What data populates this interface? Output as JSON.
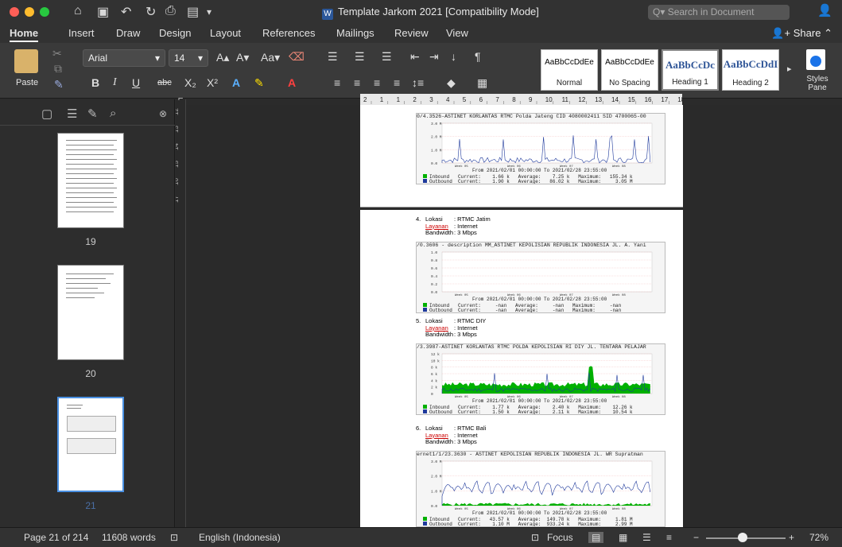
{
  "title_bar": {
    "doc_title": "Template Jarkom 2021 [Compatibility Mode]",
    "search_placeholder": "Search in Document"
  },
  "tabs": [
    "Home",
    "Insert",
    "Draw",
    "Design",
    "Layout",
    "References",
    "Mailings",
    "Review",
    "View"
  ],
  "share_label": "Share",
  "ribbon": {
    "paste_label": "Paste",
    "font_name": "Arial",
    "font_size": "14",
    "styles": [
      {
        "preview": "AaBbCcDdEe",
        "name": "Normal"
      },
      {
        "preview": "AaBbCcDdEe",
        "name": "No Spacing"
      },
      {
        "preview": "AaBbCcDc",
        "name": "Heading 1"
      },
      {
        "preview": "AaBbCcDdI",
        "name": "Heading 2"
      }
    ],
    "styles_pane_label": "Styles Pane"
  },
  "sidebar": {
    "pages": [
      "19",
      "20",
      "21"
    ]
  },
  "vruler_labels": [
    "12",
    "13",
    "14",
    "15",
    "16",
    "17"
  ],
  "hruler_labels": [
    "2",
    "1",
    "1",
    "2",
    "3",
    "4",
    "5",
    "6",
    "7",
    "8",
    "9",
    "10",
    "11",
    "12",
    "13",
    "14",
    "15",
    "16",
    "17",
    "18"
  ],
  "document": {
    "graph0": {
      "title": "0/4.3526-ASTINET KORLANTAS RTMC Polda Jateng CID 4080002411 SID 4700065-00",
      "yticks": [
        "3.0 M",
        "2.0 M",
        "1.0 M",
        "0.0"
      ],
      "weeks": [
        "Week 05",
        "Week 06",
        "Week 07",
        "Week 08"
      ],
      "from": "From 2021/02/01 00:00:00 To 2021/02/28 23:55:00",
      "inbound": "Inbound   Current:    1.66 k   Average:    7.25 k   Maximum:   155.34 k",
      "outbound": "Outbound  Current:    1.90 k   Average:   86.02 k   Maximum:     3.05 M"
    },
    "items": [
      {
        "number": "4.",
        "lokasi_label": "Lokasi",
        "lokasi": ": RTMC Jatim",
        "layanan_label": "Layanan",
        "layanan": ": Internet",
        "bandwidth_label": "Bandwidth",
        "bandwidth": ": 3 Mbps",
        "graph_title": "/0.3606 - description MM_ASTINET KEPOLISIAN REPUBLIK INDONESIA JL. A. Yani",
        "yticks": [
          "1.0",
          "0.8",
          "0.6",
          "0.4",
          "0.2",
          "0.0"
        ],
        "from": "From 2021/02/01 00:00:00 To 2021/02/28 23:55:00",
        "inbound": "Inbound   Current:     -nan   Average:     -nan   Maximum:     -nan",
        "outbound": "Outbound  Current:     -nan   Average:     -nan   Maximum:     -nan"
      },
      {
        "number": "5.",
        "lokasi_label": "Lokasi",
        "lokasi": ": RTMC DIY",
        "layanan_label": "Layanan",
        "layanan": ": Internet",
        "bandwidth_label": "Bandwidth",
        "bandwidth": ": 3 Mbps",
        "graph_title": "/3.3987-ASTINET KORLANTAS RTMC POLDA KEPOLISIAN RI DIY JL. TENTARA PELAJAR",
        "yticks": [
          "12 k",
          "10 k",
          "8 k",
          "6 k",
          "4 k",
          "2 k",
          "0"
        ],
        "from": "From 2021/02/01 00:00:00 To 2021/02/28 23:55:00",
        "inbound": "Inbound   Current:    1.77 k   Average:    2.40 k   Maximum:    12.26 k",
        "outbound": "Outbound  Current:    1.50 k   Average:    2.11 k   Maximum:    10.54 k"
      },
      {
        "number": "6.",
        "lokasi_label": "Lokasi",
        "lokasi": ": RTMC Bali",
        "layanan_label": "Layanan",
        "layanan": ": Internet",
        "bandwidth_label": "Bandwidth",
        "bandwidth": ": 3 Mbps",
        "graph_title": "ernet1/1/23.3630 - ASTINET KEPOLISIAN REPUBLIK INDONESIA JL. WR Supratman",
        "yticks": [
          "3.0 M",
          "2.0 M",
          "1.0 M",
          "0.0"
        ],
        "from": "From 2021/02/01 00:00:00 To 2021/02/28 23:55:00",
        "inbound": "Inbound   Current:   43.57 k   Average:  149.78 k   Maximum:     1.81 M",
        "outbound": "Outbound  Current:    1.10 M   Average:  933.24 k   Maximum:     2.99 M"
      }
    ]
  },
  "status_bar": {
    "page": "Page 21 of 214",
    "words": "11608 words",
    "language": "English (Indonesia)",
    "focus": "Focus",
    "zoom": "72%"
  },
  "colors": {
    "inbound": "#00b000",
    "outbound": "#1f3a9c"
  }
}
